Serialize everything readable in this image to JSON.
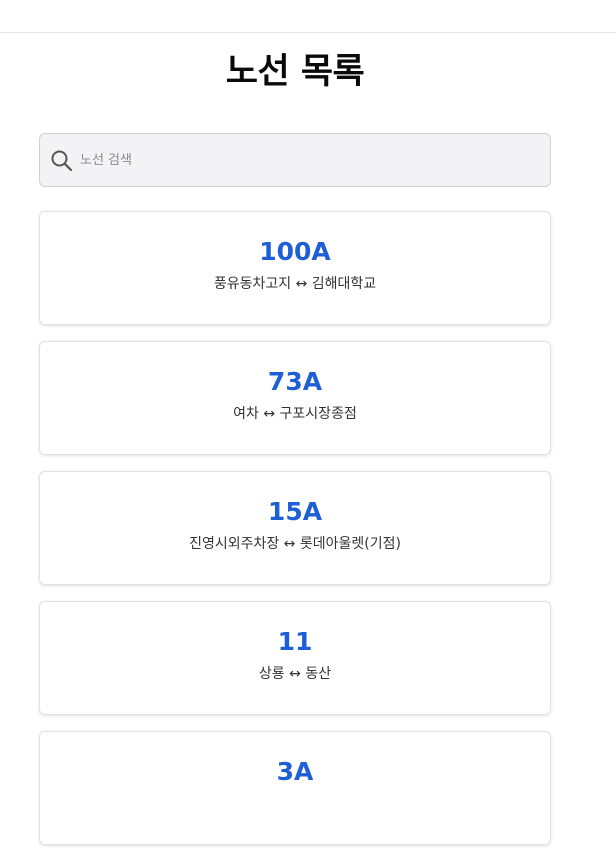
{
  "page": {
    "title": "노선 목록"
  },
  "search": {
    "placeholder": "노선 검색",
    "value": "",
    "icon": "search-icon"
  },
  "colors": {
    "accent": "#1f5fd6",
    "card_border": "#e2e2e6",
    "search_bg": "#f3f3f5"
  },
  "routes": [
    {
      "number": "100A",
      "description": "풍유동차고지 ↔ 김해대학교"
    },
    {
      "number": "73A",
      "description": "여차 ↔ 구포시장종점"
    },
    {
      "number": "15A",
      "description": "진영시외주차장 ↔ 롯데아울렛(기점)"
    },
    {
      "number": "11",
      "description": "상룡 ↔ 동산"
    },
    {
      "number": "3A",
      "description": ""
    }
  ]
}
